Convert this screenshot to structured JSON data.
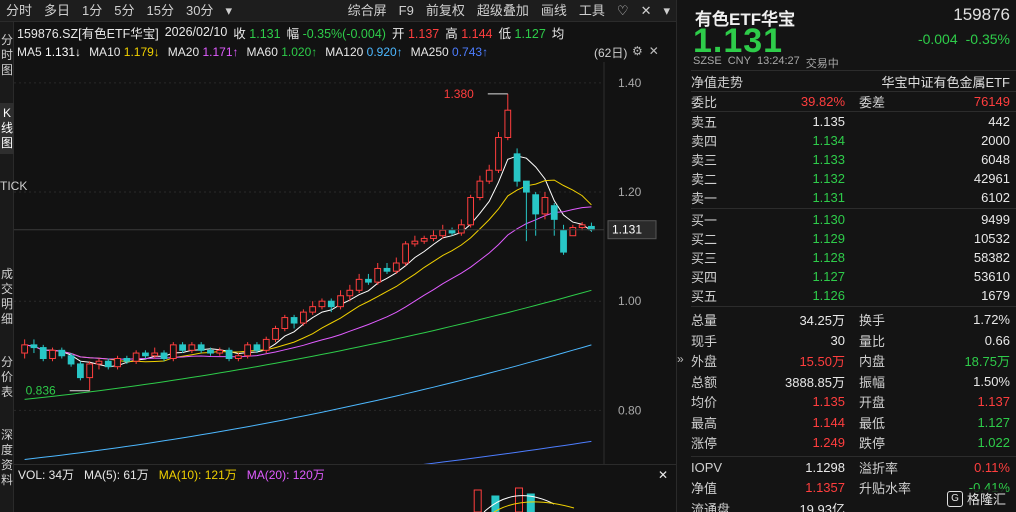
{
  "toolbar": {
    "left": [
      "分时",
      "多日",
      "1分",
      "5分",
      "15分",
      "30分",
      "▾"
    ],
    "right": [
      "综合屏",
      "F9",
      "前复权",
      "超级叠加",
      "画线",
      "工具",
      "♡",
      "✕",
      "▾"
    ]
  },
  "side_tabs": [
    "分时图",
    "K线图",
    "TICK",
    "成交明细",
    "分价表",
    "深度资料"
  ],
  "info": {
    "symbol": "159876.SZ[有色ETF华宝]",
    "date": "2026/02/10",
    "close_label": "收",
    "close": "1.131",
    "amp_label": "幅",
    "amp": "-0.35%(-0.004)",
    "open_label": "开",
    "open": "1.137",
    "high_label": "高",
    "high": "1.144",
    "low_label": "低",
    "low": "1.127",
    "avg_label": "均"
  },
  "ma": [
    {
      "label": "MA5",
      "value": "1.131↓",
      "color": "#ffffff"
    },
    {
      "label": "MA10",
      "value": "1.179↓",
      "color": "#f0d000"
    },
    {
      "label": "MA20",
      "value": "1.171↑",
      "color": "#e05cff"
    },
    {
      "label": "MA60",
      "value": "1.020↑",
      "color": "#2ecc4a"
    },
    {
      "label": "MA120",
      "value": "0.920↑",
      "color": "#4db8ff"
    },
    {
      "label": "MA250",
      "value": "0.743↑",
      "color": "#4d7dff"
    }
  ],
  "period_label": "(62日)",
  "chart_data": {
    "type": "candlestick",
    "y_ticks": [
      "1.40",
      "1.20",
      "1.00",
      "0.80"
    ],
    "ylim": [
      0.72,
      1.42
    ],
    "current_price_tag": "1.131",
    "max_label": "1.380",
    "min_label": "0.836",
    "candles": [
      [
        0.905,
        0.92,
        0.93,
        0.895
      ],
      [
        0.92,
        0.915,
        0.93,
        0.905
      ],
      [
        0.915,
        0.895,
        0.92,
        0.89
      ],
      [
        0.895,
        0.91,
        0.915,
        0.89
      ],
      [
        0.91,
        0.9,
        0.915,
        0.895
      ],
      [
        0.9,
        0.885,
        0.905,
        0.88
      ],
      [
        0.885,
        0.86,
        0.89,
        0.855
      ],
      [
        0.86,
        0.885,
        0.89,
        0.836
      ],
      [
        0.885,
        0.89,
        0.895,
        0.875
      ],
      [
        0.89,
        0.88,
        0.895,
        0.875
      ],
      [
        0.88,
        0.895,
        0.9,
        0.875
      ],
      [
        0.895,
        0.89,
        0.9,
        0.885
      ],
      [
        0.89,
        0.905,
        0.91,
        0.885
      ],
      [
        0.905,
        0.9,
        0.91,
        0.895
      ],
      [
        0.9,
        0.905,
        0.915,
        0.895
      ],
      [
        0.905,
        0.895,
        0.91,
        0.89
      ],
      [
        0.895,
        0.92,
        0.925,
        0.89
      ],
      [
        0.92,
        0.91,
        0.925,
        0.905
      ],
      [
        0.91,
        0.92,
        0.925,
        0.905
      ],
      [
        0.92,
        0.91,
        0.925,
        0.905
      ],
      [
        0.91,
        0.905,
        0.915,
        0.9
      ],
      [
        0.905,
        0.91,
        0.915,
        0.9
      ],
      [
        0.91,
        0.895,
        0.915,
        0.89
      ],
      [
        0.895,
        0.9,
        0.905,
        0.89
      ],
      [
        0.9,
        0.92,
        0.925,
        0.895
      ],
      [
        0.92,
        0.91,
        0.925,
        0.905
      ],
      [
        0.91,
        0.93,
        0.935,
        0.905
      ],
      [
        0.93,
        0.95,
        0.955,
        0.925
      ],
      [
        0.95,
        0.97,
        0.975,
        0.945
      ],
      [
        0.97,
        0.96,
        0.975,
        0.95
      ],
      [
        0.96,
        0.98,
        0.985,
        0.955
      ],
      [
        0.98,
        0.99,
        1.0,
        0.975
      ],
      [
        0.99,
        1.0,
        1.005,
        0.985
      ],
      [
        1.0,
        0.99,
        1.005,
        0.98
      ],
      [
        0.99,
        1.01,
        1.02,
        0.985
      ],
      [
        1.01,
        1.02,
        1.03,
        1.0
      ],
      [
        1.02,
        1.04,
        1.05,
        1.015
      ],
      [
        1.04,
        1.035,
        1.05,
        1.03
      ],
      [
        1.035,
        1.06,
        1.07,
        1.03
      ],
      [
        1.06,
        1.055,
        1.07,
        1.05
      ],
      [
        1.055,
        1.07,
        1.08,
        1.05
      ],
      [
        1.07,
        1.105,
        1.11,
        1.065
      ],
      [
        1.105,
        1.11,
        1.12,
        1.1
      ],
      [
        1.11,
        1.115,
        1.12,
        1.105
      ],
      [
        1.115,
        1.12,
        1.13,
        1.11
      ],
      [
        1.12,
        1.13,
        1.14,
        1.115
      ],
      [
        1.13,
        1.125,
        1.135,
        1.12
      ],
      [
        1.125,
        1.14,
        1.15,
        1.12
      ],
      [
        1.14,
        1.19,
        1.195,
        1.135
      ],
      [
        1.19,
        1.22,
        1.23,
        1.185
      ],
      [
        1.22,
        1.24,
        1.25,
        1.215
      ],
      [
        1.24,
        1.3,
        1.31,
        1.235
      ],
      [
        1.3,
        1.35,
        1.38,
        1.295
      ],
      [
        1.27,
        1.22,
        1.28,
        1.21
      ],
      [
        1.22,
        1.2,
        1.215,
        1.11
      ],
      [
        1.195,
        1.16,
        1.2,
        1.12
      ],
      [
        1.16,
        1.19,
        1.2,
        1.15
      ],
      [
        1.175,
        1.15,
        1.18,
        1.12
      ],
      [
        1.13,
        1.09,
        1.14,
        1.085
      ],
      [
        1.12,
        1.135,
        1.14,
        1.125
      ],
      [
        1.135,
        1.14,
        1.145,
        1.13
      ],
      [
        1.137,
        1.131,
        1.144,
        1.127
      ]
    ]
  },
  "volume": {
    "label": "VOL: 34万",
    "ma5": "MA(5): 61万",
    "ma10": "MA(10): 121万",
    "ma20": "MA(20): 120万"
  },
  "quote": {
    "name": "有色ETF华宝",
    "code": "159876",
    "price": "1.131",
    "change": "-0.004",
    "change_pct": "-0.35%",
    "exchange": "SZSE",
    "currency": "CNY",
    "time": "13:24:27",
    "status": "交易中",
    "nav_trend_label": "净值走势",
    "index_name": "华宝中证有色金属ETF",
    "weibi_label": "委比",
    "weibi": "39.82%",
    "weicha_label": "委差",
    "weicha": "76149",
    "asks": [
      {
        "label": "卖五",
        "price": "1.135",
        "vol": "442"
      },
      {
        "label": "卖四",
        "price": "1.134",
        "vol": "2000"
      },
      {
        "label": "卖三",
        "price": "1.133",
        "vol": "6048"
      },
      {
        "label": "卖二",
        "price": "1.132",
        "vol": "42961"
      },
      {
        "label": "卖一",
        "price": "1.131",
        "vol": "6102"
      }
    ],
    "bids": [
      {
        "label": "买一",
        "price": "1.130",
        "vol": "9499"
      },
      {
        "label": "买二",
        "price": "1.129",
        "vol": "10532"
      },
      {
        "label": "买三",
        "price": "1.128",
        "vol": "58382"
      },
      {
        "label": "买四",
        "price": "1.127",
        "vol": "53610"
      },
      {
        "label": "买五",
        "price": "1.126",
        "vol": "1679"
      }
    ],
    "stats": [
      {
        "l1": "总量",
        "v1": "34.25万",
        "c1": "white",
        "l2": "换手",
        "v2": "1.72%",
        "c2": "white"
      },
      {
        "l1": "现手",
        "v1": "30",
        "c1": "white",
        "l2": "量比",
        "v2": "0.66",
        "c2": "white"
      },
      {
        "l1": "外盘",
        "v1": "15.50万",
        "c1": "red",
        "l2": "内盘",
        "v2": "18.75万",
        "c2": "green"
      },
      {
        "l1": "总额",
        "v1": "3888.85万",
        "c1": "white",
        "l2": "振幅",
        "v2": "1.50%",
        "c2": "white"
      },
      {
        "l1": "均价",
        "v1": "1.135",
        "c1": "red",
        "l2": "开盘",
        "v2": "1.137",
        "c2": "red"
      },
      {
        "l1": "最高",
        "v1": "1.144",
        "c1": "red",
        "l2": "最低",
        "v2": "1.127",
        "c2": "green"
      },
      {
        "l1": "涨停",
        "v1": "1.249",
        "c1": "red",
        "l2": "跌停",
        "v2": "1.022",
        "c2": "green"
      }
    ],
    "stats2": [
      {
        "l1": "IOPV",
        "v1": "1.1298",
        "c1": "white",
        "l2": "溢折率",
        "v2": "0.11%",
        "c2": "red"
      },
      {
        "l1": "净值",
        "v1": "1.1357",
        "c1": "red",
        "l2": "升贴水率",
        "v2": "-0.41%",
        "c2": "green"
      },
      {
        "l1": "流通盘",
        "v1": "19.93亿",
        "c1": "white",
        "l2": "",
        "v2": "",
        "c2": "white"
      }
    ]
  },
  "watermark": "格隆汇"
}
